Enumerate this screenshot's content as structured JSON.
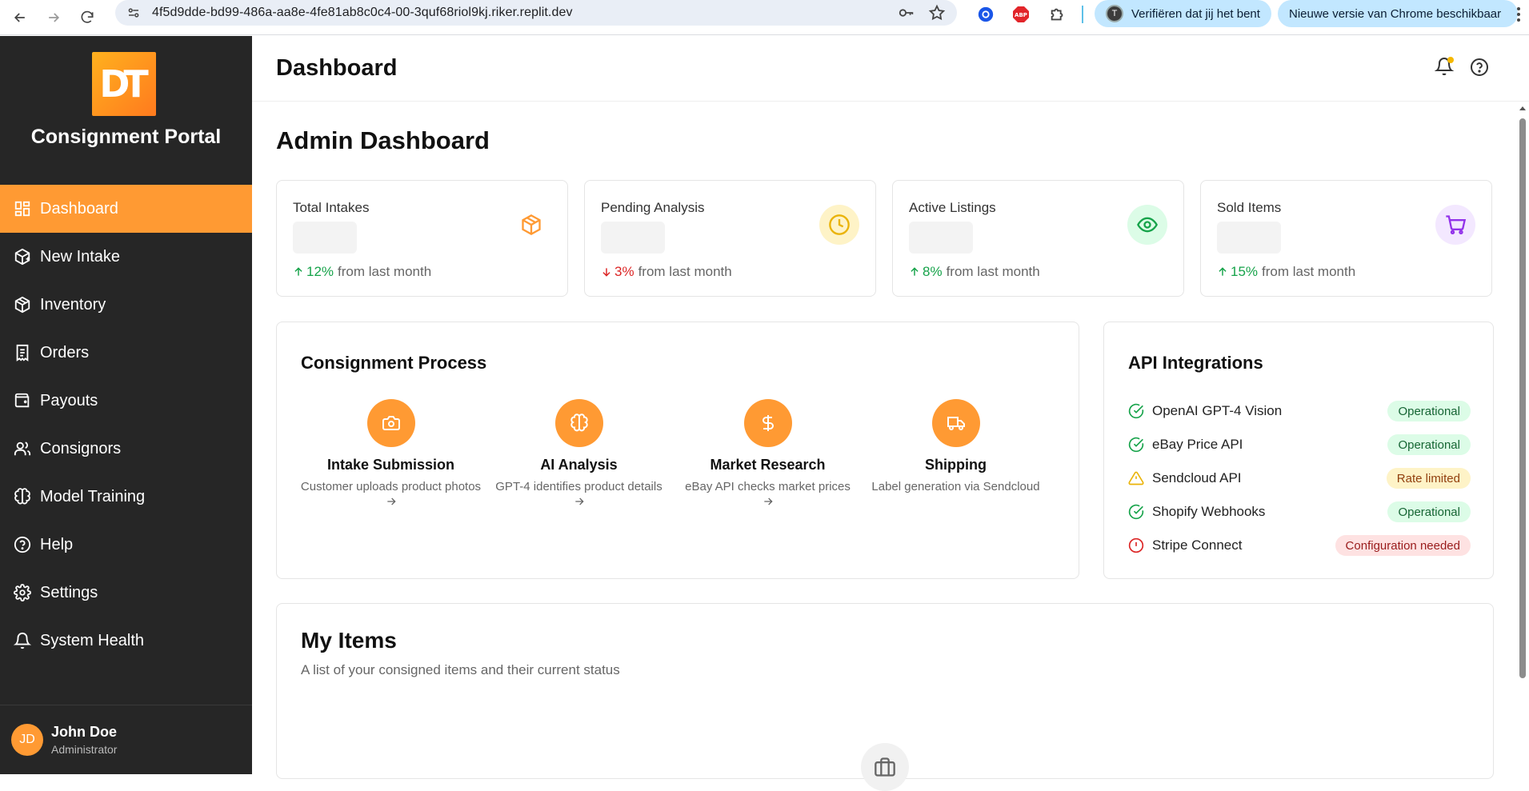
{
  "browser": {
    "url": "4f5d9dde-bd99-486a-aa8e-4fe81ab8c0c4-00-3quf68riol9kj.riker.replit.dev",
    "chip_profile_initial": "T",
    "chip_verify": "Verifiëren dat jij het bent",
    "chip_update": "Nieuwe versie van Chrome beschikbaar"
  },
  "sidebar": {
    "logo_text": "DT",
    "brand": "Consignment Portal",
    "items": [
      {
        "label": "Dashboard",
        "icon": "dashboard-icon",
        "active": true
      },
      {
        "label": "New Intake",
        "icon": "package-plus-icon"
      },
      {
        "label": "Inventory",
        "icon": "box-icon"
      },
      {
        "label": "Orders",
        "icon": "receipt-icon"
      },
      {
        "label": "Payouts",
        "icon": "wallet-icon"
      },
      {
        "label": "Consignors",
        "icon": "users-icon"
      },
      {
        "label": "Model Training",
        "icon": "brain-icon"
      },
      {
        "label": "Help",
        "icon": "help-circle-icon"
      },
      {
        "label": "Settings",
        "icon": "gear-icon"
      },
      {
        "label": "System Health",
        "icon": "bell-icon"
      }
    ],
    "user": {
      "initials": "JD",
      "name": "John Doe",
      "role": "Administrator"
    }
  },
  "header": {
    "title": "Dashboard"
  },
  "main": {
    "title": "Admin Dashboard",
    "stats": [
      {
        "label": "Total Intakes",
        "pct": "12%",
        "suffix": "from last month",
        "direction": "up",
        "icon": "package-icon"
      },
      {
        "label": "Pending Analysis",
        "pct": "3%",
        "suffix": "from last month",
        "direction": "down",
        "icon": "clock-icon"
      },
      {
        "label": "Active Listings",
        "pct": "8%",
        "suffix": "from last month",
        "direction": "up",
        "icon": "eye-icon"
      },
      {
        "label": "Sold Items",
        "pct": "15%",
        "suffix": "from last month",
        "direction": "up",
        "icon": "cart-icon"
      }
    ],
    "process": {
      "title": "Consignment Process",
      "steps": [
        {
          "title": "Intake Submission",
          "desc": "Customer uploads product photos",
          "icon": "camera-icon"
        },
        {
          "title": "AI Analysis",
          "desc": "GPT-4 identifies product details",
          "icon": "brain-icon"
        },
        {
          "title": "Market Research",
          "desc": "eBay API checks market prices",
          "icon": "dollar-icon"
        },
        {
          "title": "Shipping",
          "desc": "Label generation via Sendcloud",
          "icon": "truck-icon"
        }
      ]
    },
    "api": {
      "title": "API Integrations",
      "items": [
        {
          "name": "OpenAI GPT-4 Vision",
          "status": "Operational",
          "level": "ok"
        },
        {
          "name": "eBay Price API",
          "status": "Operational",
          "level": "ok"
        },
        {
          "name": "Sendcloud API",
          "status": "Rate limited",
          "level": "warn"
        },
        {
          "name": "Shopify Webhooks",
          "status": "Operational",
          "level": "ok"
        },
        {
          "name": "Stripe Connect",
          "status": "Configuration needed",
          "level": "err"
        }
      ]
    },
    "my_items": {
      "title": "My Items",
      "subtitle": "A list of your consigned items and their current status"
    }
  },
  "colors": {
    "accent": "#ff9a33",
    "sidebar_bg": "#262626",
    "up": "#16a34a",
    "down": "#dc2626"
  }
}
